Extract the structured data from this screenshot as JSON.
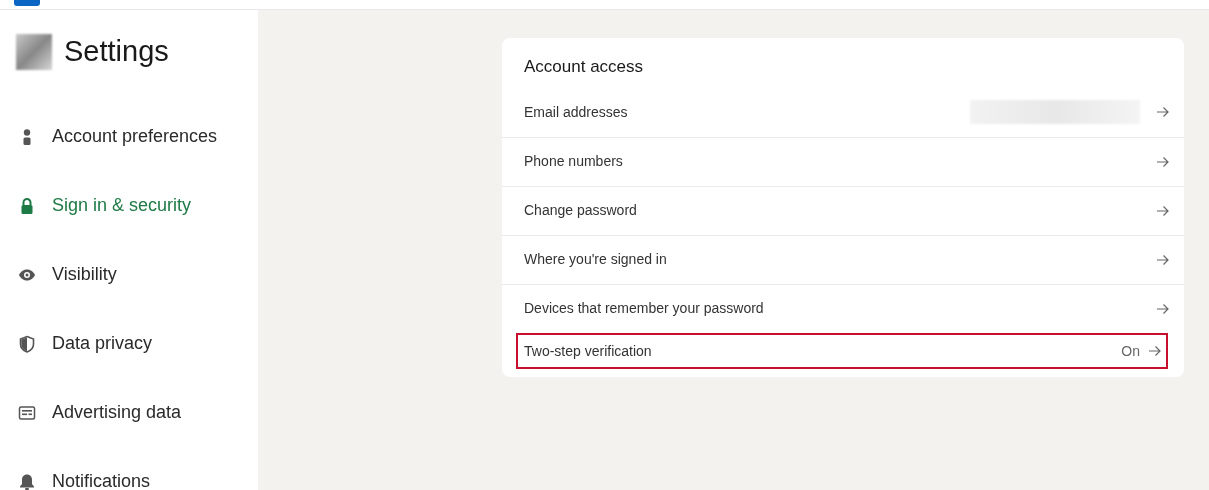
{
  "sidebar": {
    "title": "Settings",
    "items": [
      {
        "label": "Account preferences",
        "selected": false
      },
      {
        "label": "Sign in & security",
        "selected": true
      },
      {
        "label": "Visibility",
        "selected": false
      },
      {
        "label": "Data privacy",
        "selected": false
      },
      {
        "label": "Advertising data",
        "selected": false
      },
      {
        "label": "Notifications",
        "selected": false
      }
    ]
  },
  "card": {
    "title": "Account access",
    "rows": [
      {
        "label": "Email addresses",
        "redacted": true,
        "highlighted": false
      },
      {
        "label": "Phone numbers",
        "redacted": false,
        "highlighted": false
      },
      {
        "label": "Change password",
        "redacted": false,
        "highlighted": false
      },
      {
        "label": "Where you're signed in",
        "redacted": false,
        "highlighted": false
      },
      {
        "label": "Devices that remember your password",
        "redacted": false,
        "highlighted": false
      },
      {
        "label": "Two-step verification",
        "value": "On",
        "redacted": false,
        "highlighted": true
      }
    ]
  }
}
